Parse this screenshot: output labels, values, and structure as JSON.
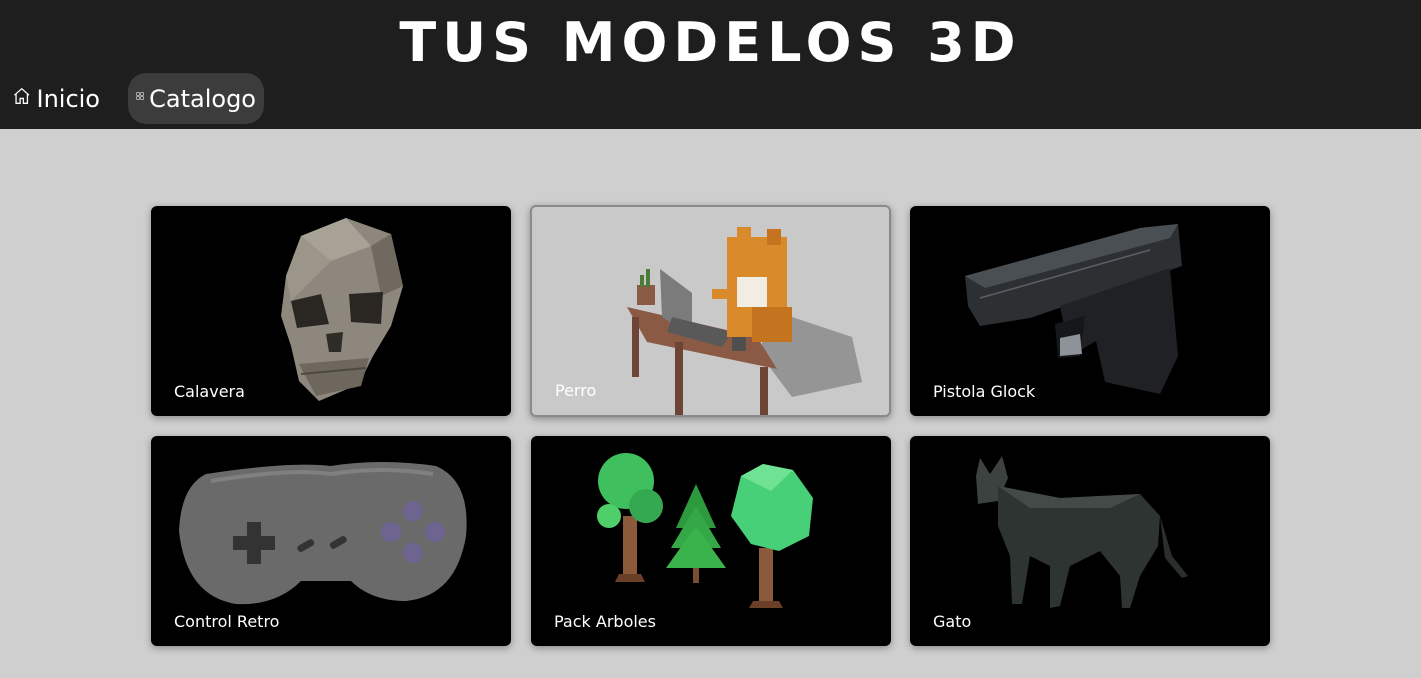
{
  "header": {
    "title": "TUS MODELOS 3D",
    "nav": [
      {
        "label": "Inicio",
        "icon": "home-icon"
      },
      {
        "label": "Catalogo",
        "icon": "grid-icon",
        "active": true
      }
    ]
  },
  "catalog": {
    "items": [
      {
        "label": "Calavera",
        "image": "skull-model"
      },
      {
        "label": "Perro",
        "image": "dog-at-desk-model"
      },
      {
        "label": "Pistola Glock",
        "image": "pistol-model"
      },
      {
        "label": "Control Retro",
        "image": "retro-controller-model"
      },
      {
        "label": "Pack Arboles",
        "image": "trees-pack-model"
      },
      {
        "label": "Gato",
        "image": "cat-model"
      }
    ]
  },
  "colors": {
    "header_bg": "#1e1e1e",
    "page_bg": "#cfcfcf",
    "card_bg": "#000000",
    "active_nav_bg": "#3c3c3c"
  }
}
